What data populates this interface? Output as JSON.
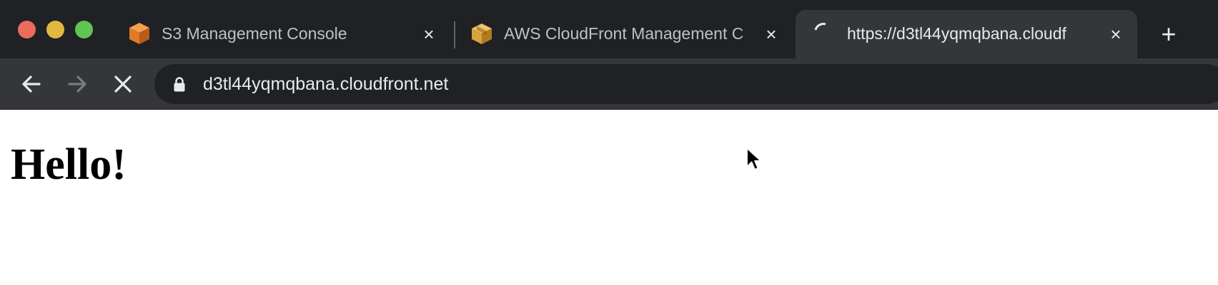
{
  "window": {
    "controls": [
      "close",
      "minimize",
      "maximize"
    ]
  },
  "tabs": [
    {
      "title": "S3 Management Console",
      "icon": "s3-bucket-icon",
      "active": false
    },
    {
      "title": "AWS CloudFront Management C",
      "icon": "aws-box-icon",
      "active": false
    },
    {
      "title": "https://d3tl44yqmqbana.cloudf",
      "icon": "loading-spinner-icon",
      "active": true,
      "loading": true
    }
  ],
  "toolbar": {
    "back_icon": "arrow-left-icon",
    "forward_icon": "arrow-right-icon",
    "stop_icon": "close-icon",
    "url": "d3tl44yqmqbana.cloudfront.net",
    "lock_icon": "lock-icon"
  },
  "page": {
    "heading": "Hello!"
  },
  "colors": {
    "tabstrip_bg": "#202124",
    "toolbar_bg": "#35363a",
    "omnibox_bg": "#202124",
    "s3_orange": "#e07b24",
    "aws_gold": "#d9a23a"
  }
}
